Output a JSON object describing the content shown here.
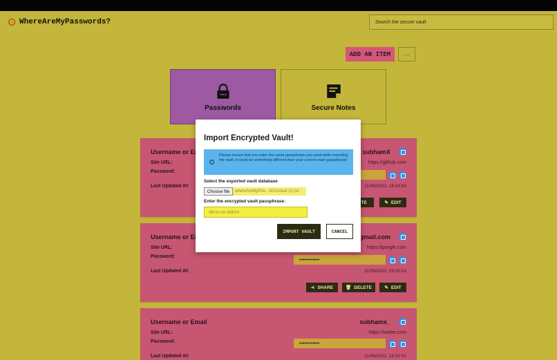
{
  "app": {
    "title": "WhereAreMyPasswords?"
  },
  "search": {
    "placeholder": "Search the secure vault"
  },
  "toolbar": {
    "add_label": "ADD AN ITEM",
    "more_label": "···"
  },
  "tiles": [
    {
      "label": "Passwords",
      "icon": "lock-icon",
      "selected": true
    },
    {
      "label": "Secure Notes",
      "icon": "note-icon",
      "selected": false
    }
  ],
  "labels": {
    "username": "Username or Email",
    "site_url": "Site URL:",
    "password": "Password:",
    "last_updated": "Last Updated At:",
    "share": "SHARE",
    "delete": "DELETE",
    "edit": "EDIT"
  },
  "cards": [
    {
      "username": "subhamX",
      "site_url": "https://github.com",
      "password_mask": "",
      "updated": "11/09/2022, 19:24:04"
    },
    {
      "username": "@gmail.com",
      "site_url": "https://google.com",
      "password_mask": "••••••••••••",
      "updated": "11/09/2022, 19:20:23"
    },
    {
      "username": "subhamx_",
      "site_url": "https://twitter.com",
      "password_mask": "••••••••••••",
      "updated": "11/09/2022, 19:20:51"
    }
  ],
  "modal": {
    "title": "Import Encrypted Vault!",
    "info": "Please ensure that you enter the same passphrase you used while exporting the vault. It could be something different than your current main passphrase!",
    "file_label": "Select the exported vault database",
    "file_button": "Choose file",
    "file_name": "whereAreMyPas...sEncVault (1).txt",
    "pass_label": "Enter the encrypted vault passphrase:",
    "pass_placeholder": "abra-ca-dabra",
    "import_label": "IMPORT VAULT",
    "cancel_label": "CANCEL"
  },
  "colors": {
    "background": "#c4b63b",
    "card": "#c75672",
    "tile_selected": "#9d5aa3",
    "accent_button": "#d4577a",
    "dark_button": "#2c2c14",
    "info_box": "#5ab4ed",
    "icon_blue": "#2e8fe0"
  }
}
